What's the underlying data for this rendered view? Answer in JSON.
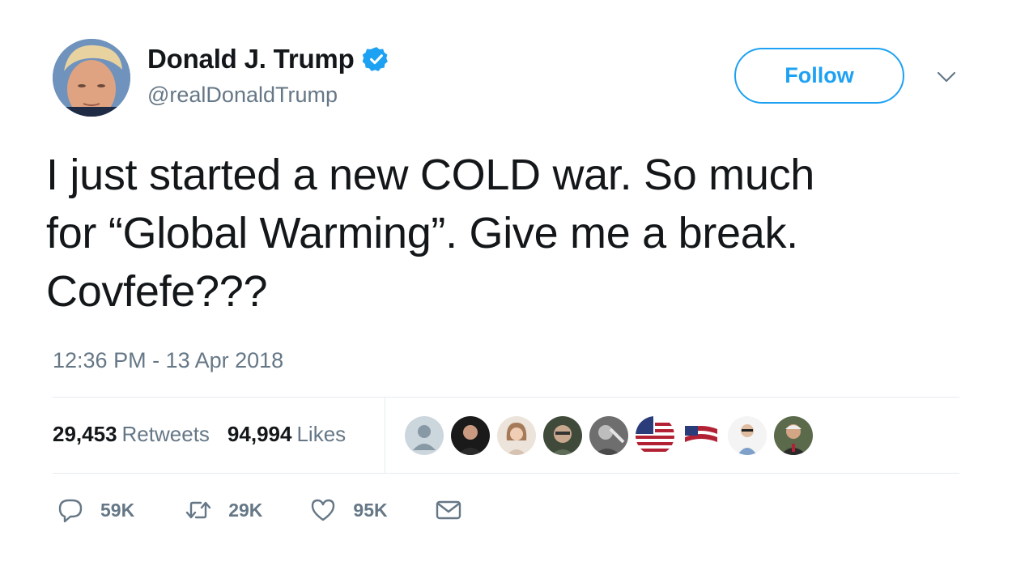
{
  "author": {
    "display_name": "Donald J. Trump",
    "handle": "@realDonaldTrump",
    "verified": true
  },
  "follow_button": {
    "label": "Follow"
  },
  "tweet": {
    "line1": "I just started a new COLD war. So much",
    "line2": "for “Global Warming”. Give me a break.",
    "line3": "Covfefe???",
    "timestamp": "12:36 PM - 13 Apr 2018"
  },
  "stats": {
    "retweets_count": "29,453",
    "retweets_label": "Retweets",
    "likes_count": "94,994",
    "likes_label": "Likes"
  },
  "actions": {
    "reply_count": "59K",
    "retweet_count": "29K",
    "like_count": "95K"
  },
  "colors": {
    "accent": "#1da1f2",
    "text": "#14171a",
    "muted": "#657786",
    "divider": "#e6ecf0"
  },
  "icons": [
    "verified-badge-icon",
    "chevron-down-icon",
    "reply-icon",
    "retweet-icon",
    "heart-icon",
    "mail-icon"
  ]
}
